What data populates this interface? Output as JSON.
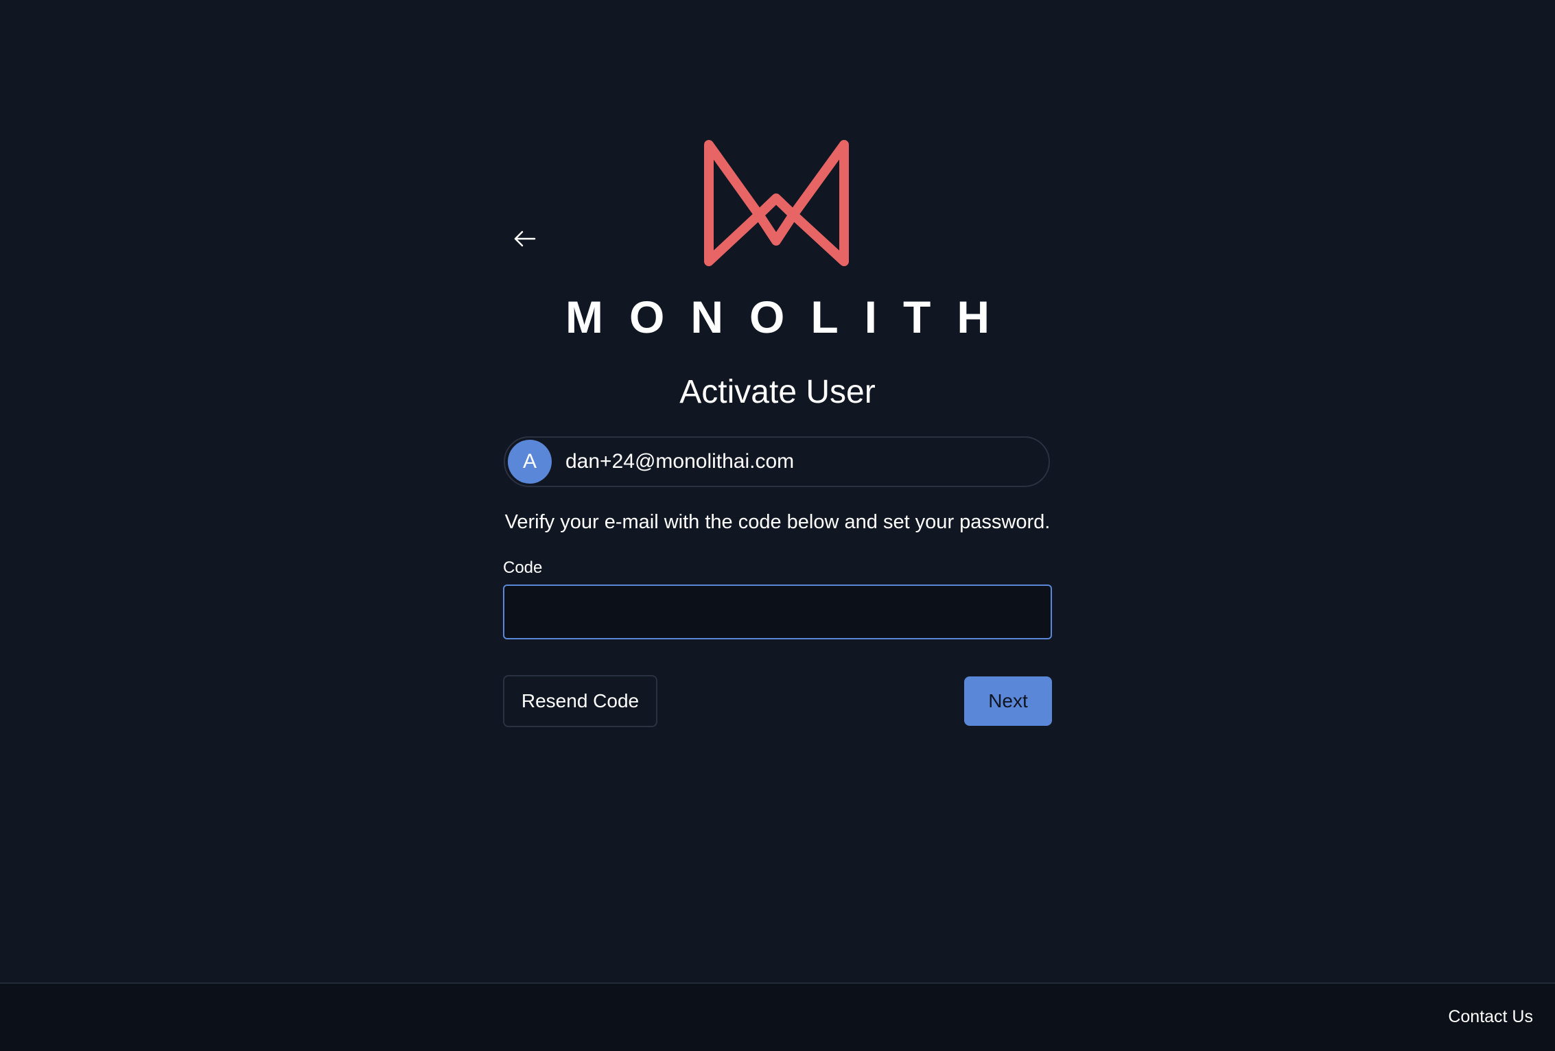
{
  "brand": {
    "name": "MONOLITH",
    "logo_icon": "monolith-logo-icon",
    "logo_color": "#e86565"
  },
  "colors": {
    "background": "#111722",
    "accent": "#5b87d9",
    "footer_background": "#0c1119"
  },
  "header": {
    "back_icon": "arrow-left-icon"
  },
  "main": {
    "title": "Activate User",
    "account": {
      "avatar_initial": "A",
      "email": "dan+24@monolithai.com"
    },
    "instruction": "Verify your e-mail with the code below and set your password.",
    "code_field": {
      "label": "Code",
      "value": "",
      "placeholder": ""
    },
    "resend_label": "Resend Code",
    "next_label": "Next"
  },
  "footer": {
    "contact_label": "Contact Us"
  }
}
